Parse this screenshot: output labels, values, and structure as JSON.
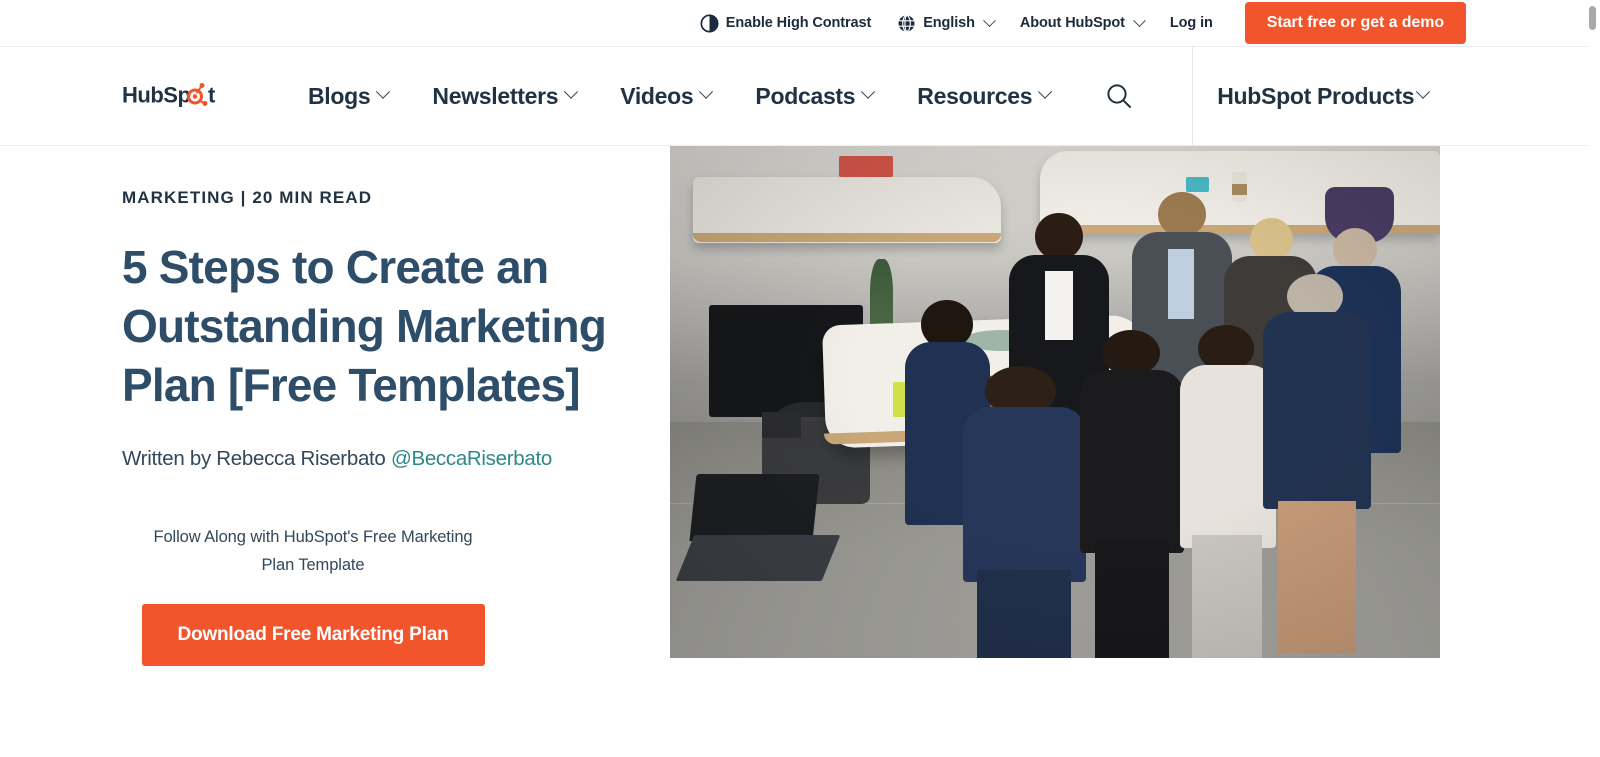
{
  "utility_bar": {
    "contrast_toggle": "Enable High Contrast",
    "language": "English",
    "about": "About HubSpot",
    "login": "Log in",
    "cta": "Start free or get a demo",
    "icons": {
      "contrast": "contrast-icon",
      "globe": "globe-icon",
      "chevron": "chevron-down-icon"
    }
  },
  "nav": {
    "logo_text": "HubSpot",
    "logo_part_1": "HubSp",
    "logo_part_2": "t",
    "items": [
      {
        "label": "Blogs",
        "has_dropdown": true
      },
      {
        "label": "Newsletters",
        "has_dropdown": true
      },
      {
        "label": "Videos",
        "has_dropdown": true
      },
      {
        "label": "Podcasts",
        "has_dropdown": true
      },
      {
        "label": "Resources",
        "has_dropdown": true
      }
    ],
    "search_icon": "search-icon",
    "products": "HubSpot Products"
  },
  "article": {
    "eyebrow": "MARKETING | 20 MIN READ",
    "headline": "5 Steps to Create an Outstanding Marketing Plan [Free Templates]",
    "byline_prefix": "Written by Rebecca Riserbato ",
    "byline_handle": "@BeccaRiserbato",
    "cta_caption": "Follow Along with HubSpot's Free Marketing Plan Template",
    "cta_button": "Download Free Marketing Plan"
  },
  "hero_image": {
    "alt": "Group of office workers standing in a circle in a modern open-plan office having a discussion"
  },
  "colors": {
    "brand_orange": "#f2552c",
    "navy": "#213343",
    "headline_blue": "#2d4d68",
    "teal_link": "#2e8888"
  }
}
